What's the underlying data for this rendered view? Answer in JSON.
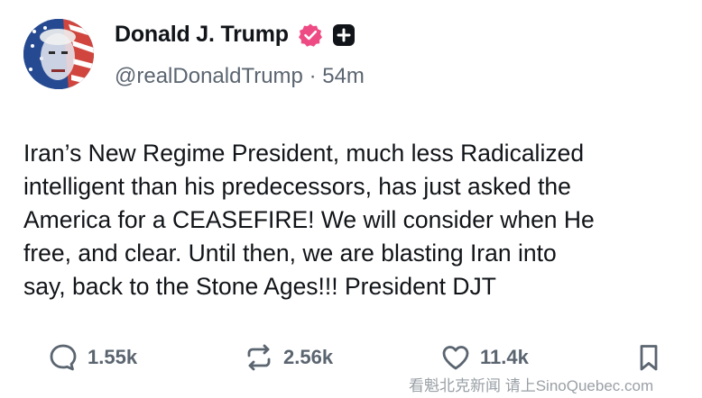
{
  "author": {
    "name": "Donald J. Trump",
    "handle": "@realDonaldTrump",
    "separator": "·",
    "time": "54m"
  },
  "icons": {
    "verified": "verified-badge-icon",
    "plus": "plus-badge-icon",
    "reply": "reply-icon",
    "repost": "repost-icon",
    "like": "heart-icon",
    "bookmark": "bookmark-icon"
  },
  "colors": {
    "verified": "#ee4b84",
    "text": "#111418",
    "muted": "#5b6570"
  },
  "post": {
    "lines": [
      "Iran’s New Regime President, much less Radicalized",
      "intelligent than his predecessors, has just asked the",
      "America for a CEASEFIRE! We will consider when He",
      "free, and clear. Until then, we are blasting Iran into",
      "say, back to the Stone Ages!!! President DJT"
    ]
  },
  "actions": {
    "replies": "1.55k",
    "reposts": "2.56k",
    "likes": "11.4k"
  },
  "watermark": "看魁北克新闻 请上SinoQuebec.com"
}
